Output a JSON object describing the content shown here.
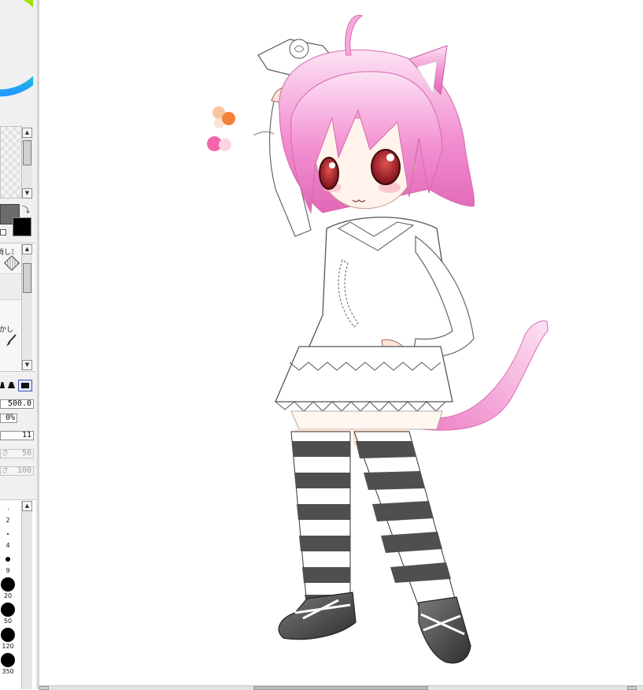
{
  "tool_panel": {
    "mode_labels": [
      "消しﾐ",
      "かし"
    ],
    "brush_size_value": "500.0",
    "min_size_value": "0%",
    "density_value": "11",
    "blending_label": "さ",
    "blending_value": "50",
    "dilution_label": "さ",
    "dilution_value": "100",
    "brush_sizes": [
      {
        "label": "2"
      },
      {
        "label": "4"
      },
      {
        "label": "9"
      },
      {
        "label": "20"
      },
      {
        "label": "50"
      },
      {
        "label": "120"
      },
      {
        "label": "350"
      }
    ],
    "main_color": "#6b6b6b",
    "sub_color": "#000000"
  },
  "swatches": {
    "orange_light": "#f7bf95",
    "orange": "#f4803a",
    "pink": "#f465a8",
    "pink_light": "#fbd3e6"
  },
  "artwork": {
    "hair_color": "#f28ed0",
    "eye_color": "#b3222a",
    "sock_dark": "#4f4f4f",
    "sock_light": "#ffffff"
  }
}
